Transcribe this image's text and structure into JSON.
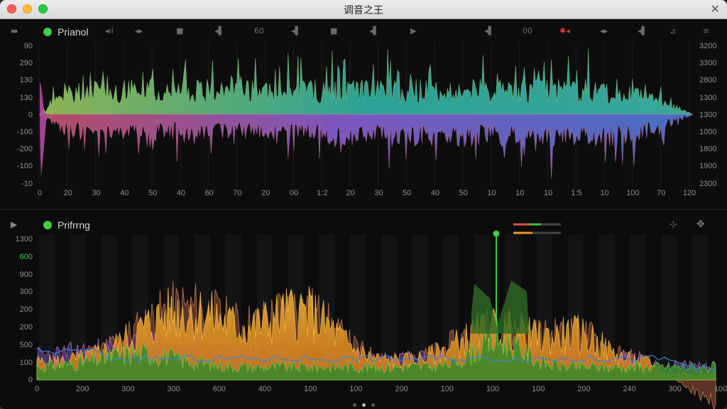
{
  "window": {
    "title": "调音之王"
  },
  "top_track": {
    "name": "Prianol",
    "toolbar": [
      "▬",
      "◂ıl",
      "◂▸",
      "■",
      "◂▌",
      "60",
      "◂▌",
      "■",
      "◂▌",
      "▶",
      "◂▌",
      "00",
      "✱◂",
      "◂▸",
      "◂▌",
      "⊿",
      "≡"
    ],
    "y_left": [
      "90",
      "290",
      "130",
      "130",
      "0",
      "-100",
      "-200",
      "-100",
      "-10"
    ],
    "y_right": [
      "3200",
      "3300",
      "2800",
      "1300",
      "1300",
      "1000",
      "1800",
      "1900",
      "2300"
    ],
    "x_ticks": [
      "0",
      "20",
      "30",
      "40",
      "50",
      "40",
      "60",
      "70",
      "20",
      "00",
      "1:2",
      "20",
      "30",
      "50",
      "40",
      "50",
      "10",
      "10",
      "10",
      "1:5",
      "10",
      "100",
      "70",
      "120"
    ]
  },
  "bottom_track": {
    "name": "Prifrrng",
    "play_icon": "▶",
    "y_left": [
      "1300",
      "600",
      "900",
      "300",
      "200",
      "200",
      "500",
      "100",
      "0"
    ],
    "x_ticks": [
      "0",
      "200",
      "300",
      "300",
      "600",
      "400",
      "100",
      "100",
      "200",
      "100",
      "100",
      "100",
      "200",
      "240",
      "300",
      "100"
    ],
    "legend": [
      {
        "color": "#e25040"
      },
      {
        "color": "#3fbf4a"
      },
      {
        "color": "#e99a2a"
      }
    ]
  },
  "colors": {
    "accent_green": "#3fce45",
    "wave_teal": "#3fb7a8",
    "wave_purple": "#7b5fd6",
    "wave_orange": "#e8a226",
    "wave_pink": "#d86ab7",
    "wave_blue": "#3c86d6",
    "wave_green": "#4fc043"
  },
  "pager": {
    "count": 3,
    "active": 1
  }
}
